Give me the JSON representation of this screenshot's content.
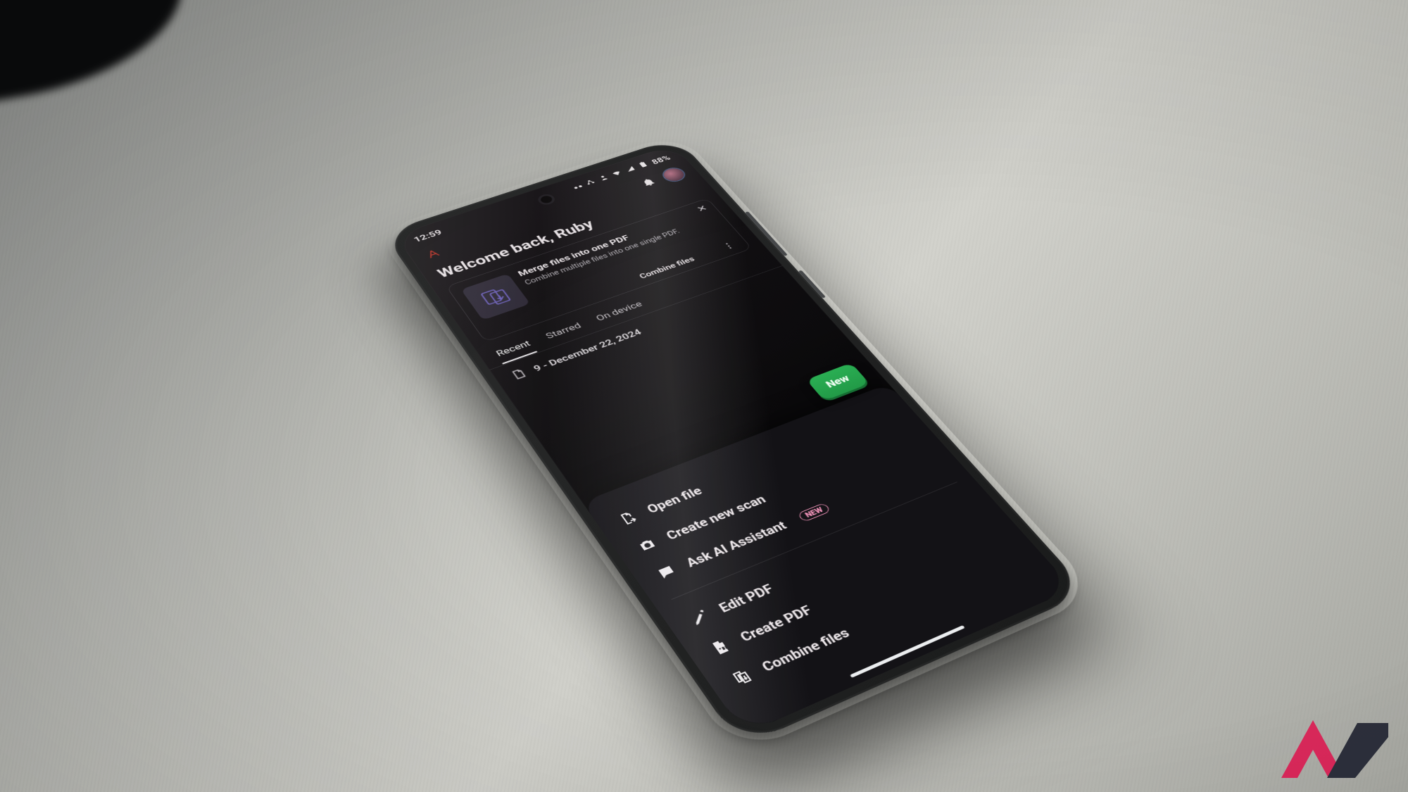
{
  "statusbar": {
    "time": "12:59",
    "battery": "88%"
  },
  "header": {
    "welcome": "Welcome back, Ruby"
  },
  "promo": {
    "title": "Merge files into one PDF",
    "subtitle": "Combine multiple files into one single PDF.",
    "cta": "Combine files",
    "close_glyph": "✕",
    "kebab": "⋮"
  },
  "tabs": {
    "items": [
      "Recent",
      "Starred",
      "On device"
    ],
    "active_index": 0
  },
  "file": {
    "name": "9 - December 22, 2024"
  },
  "fab": {
    "label": "New"
  },
  "sheet": {
    "group1": [
      {
        "label": "Open file",
        "icon": "open-file-icon"
      },
      {
        "label": "Create new scan",
        "icon": "camera-icon"
      },
      {
        "label": "Ask AI Assistant",
        "icon": "ai-icon",
        "badge": "NEW"
      }
    ],
    "group2": [
      {
        "label": "Edit PDF",
        "icon": "pencil-icon"
      },
      {
        "label": "Create PDF",
        "icon": "pdf-icon"
      },
      {
        "label": "Combine files",
        "icon": "combine-icon"
      }
    ]
  }
}
